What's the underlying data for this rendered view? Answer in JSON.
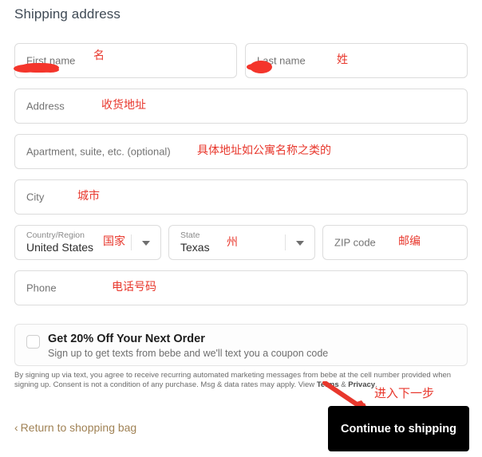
{
  "page": {
    "title": "Shipping address"
  },
  "form": {
    "fields": [
      {
        "label": "First name",
        "value": "",
        "annotation": "名"
      },
      {
        "label": "Last name",
        "value": "",
        "annotation": "姓"
      },
      {
        "label": "Address",
        "value": "",
        "annotation": "收货地址"
      },
      {
        "label": "Apartment, suite, etc. (optional)",
        "value": "",
        "annotation": "具体地址如公寓名称之类的"
      },
      {
        "label": "City",
        "value": "",
        "annotation": "城市"
      },
      {
        "label": "Country/Region",
        "value": "United States",
        "annotation": "国家"
      },
      {
        "label": "State",
        "value": "Texas",
        "annotation": "州"
      },
      {
        "label": "ZIP code",
        "value": "",
        "annotation": "邮编"
      },
      {
        "label": "Phone",
        "value": "",
        "annotation": "电话号码"
      }
    ]
  },
  "coupon": {
    "title": "Get 20% Off Your Next Order",
    "subtitle": "Sign up to get texts from bebe and we'll text you a coupon code",
    "checked": false
  },
  "legal": {
    "line1": "By signing up via text, you agree to receive recurring automated marketing messages from bebe at the cell number provided when signing up.",
    "line2_pre": "Consent is not a condition of any purchase. Msg & data rates may apply. View ",
    "terms": "Terms",
    "amp": " & ",
    "privacy": "Privacy",
    "line2_post": "."
  },
  "footer": {
    "return_chevron": "‹",
    "return_label": "Return to shopping bag",
    "continue_label": "Continue to shipping",
    "continue_annotation": "进入下一步"
  },
  "colors": {
    "annotation_red": "#e8372c",
    "cta_background": "#000000",
    "link_brown": "#a08255",
    "border_grey": "#dcdcdc"
  }
}
